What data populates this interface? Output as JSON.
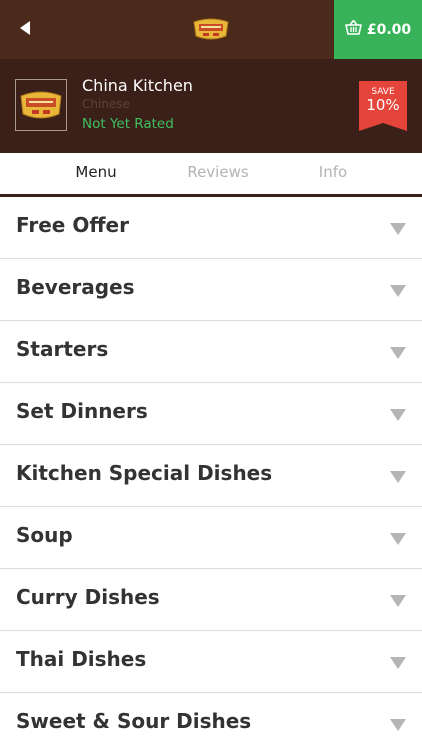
{
  "topbar": {
    "back_icon": "back-arrow-icon",
    "logo_icon": "china-kitchen-logo",
    "basket": {
      "icon": "basket-icon",
      "amount": "£0.00"
    },
    "colors": {
      "bar": "#4b2a1c",
      "basket_bg": "#38b35a"
    }
  },
  "restaurant": {
    "name": "China Kitchen",
    "cuisine": "Chinese",
    "rating": "Not Yet Rated",
    "save": {
      "label": "SAVE",
      "value": "10%"
    },
    "colors": {
      "header_bg": "#3a2019",
      "rating": "#3fbf5f",
      "badge": "#e5443a"
    }
  },
  "tabs": [
    {
      "label": "Menu",
      "active": true
    },
    {
      "label": "Reviews",
      "active": false
    },
    {
      "label": "Info",
      "active": false
    }
  ],
  "menu": {
    "arrow_icon": "chevron-down-icon",
    "categories": [
      "Free Offer",
      "Beverages",
      "Starters",
      "Set Dinners",
      "Kitchen Special Dishes",
      "Soup",
      "Curry Dishes",
      "Thai Dishes",
      "Sweet & Sour Dishes"
    ]
  }
}
